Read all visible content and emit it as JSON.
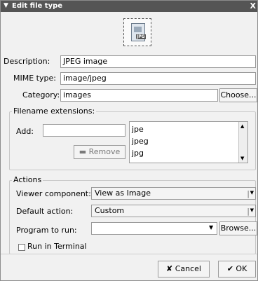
{
  "window": {
    "title": "Edit file type",
    "close_symbol": "X"
  },
  "icon": {
    "tag": "JPG"
  },
  "description": {
    "label": "Description:",
    "value": "JPEG image"
  },
  "mime": {
    "label": "MIME type:",
    "value": "image/jpeg"
  },
  "category": {
    "label": "Category:",
    "value": "images",
    "choose_button": "Choose..."
  },
  "extensions": {
    "group_label": "Filename extensions:",
    "add_label": "Add:",
    "add_value": "",
    "remove_button": "Remove",
    "items": [
      "jpe",
      "jpeg",
      "jpg"
    ]
  },
  "actions": {
    "group_label": "Actions",
    "viewer": {
      "label": "Viewer component:",
      "value": "View as Image"
    },
    "default_action": {
      "label": "Default action:",
      "value": "Custom"
    },
    "program": {
      "label": "Program to run:",
      "value": "",
      "browse_button": "Browse..."
    },
    "run_in_terminal": {
      "label": "Run in Terminal",
      "checked": false
    }
  },
  "buttons": {
    "cancel": "Cancel",
    "ok": "OK"
  }
}
